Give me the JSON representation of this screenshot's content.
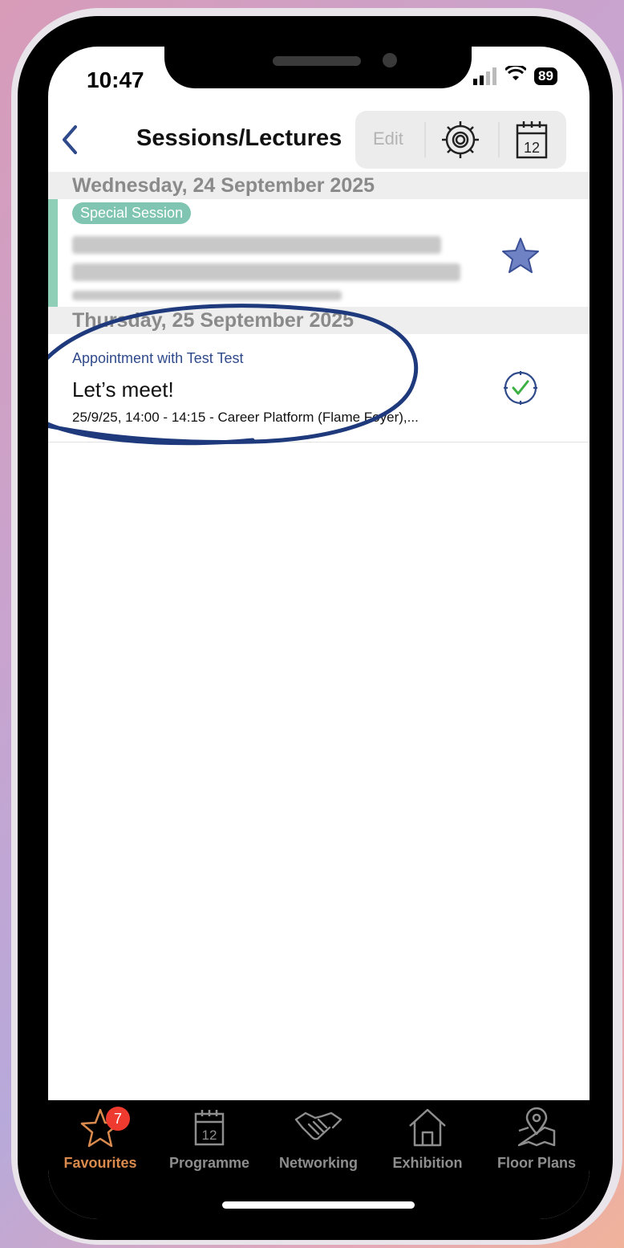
{
  "status_bar": {
    "time": "10:47",
    "battery": "89"
  },
  "nav": {
    "title": "Sessions/Lectures",
    "edit_label": "Edit",
    "calendar_day": "12"
  },
  "days": [
    {
      "header": "Wednesday, 24 September 2025",
      "items": [
        {
          "badge": "Special Session",
          "favorited": true
        }
      ]
    },
    {
      "header": "Thursday, 25 September 2025",
      "items": [
        {
          "label": "Appointment with Test Test",
          "title": "Let’s meet!",
          "details": "25/9/25, 14:00 - 14:15 - Career Platform (Flame Foyer),...",
          "status": "confirmed"
        }
      ]
    }
  ],
  "tabbar": {
    "tabs": [
      {
        "label": "Favourites",
        "icon": "star-icon",
        "badge": "7",
        "active": true
      },
      {
        "label": "Programme",
        "icon": "calendar-icon",
        "calendar_day": "12"
      },
      {
        "label": "Networking",
        "icon": "handshake-icon"
      },
      {
        "label": "Exhibition",
        "icon": "house-icon"
      },
      {
        "label": "Floor Plans",
        "icon": "map-pin-icon"
      }
    ]
  },
  "colors": {
    "accent_orange": "#d98a4c",
    "badge_green": "#7fc5b1",
    "star_blue": "#4a5fa8",
    "check_green": "#3cb043",
    "annotation": "#1e3a7c"
  }
}
